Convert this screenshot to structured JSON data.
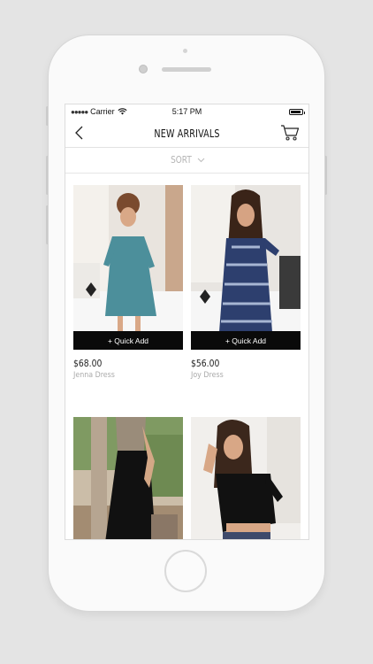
{
  "status": {
    "carrier": "Carrier",
    "time": "5:17 PM"
  },
  "nav": {
    "title": "NEW ARRIVALS",
    "back_icon": "chevron-left-icon",
    "cart_icon": "cart-icon"
  },
  "sort": {
    "label": "SORT",
    "icon": "chevron-down-icon"
  },
  "products": [
    {
      "price": "$68.00",
      "name": "Jenna Dress",
      "quick_add": "+ Quick Add"
    },
    {
      "price": "$56.00",
      "name": "Joy Dress",
      "quick_add": "+ Quick Add"
    },
    {
      "price": "",
      "name": "",
      "quick_add": ""
    },
    {
      "price": "",
      "name": "",
      "quick_add": ""
    }
  ],
  "colors": {
    "accent": "#0a0a0a",
    "muted_text": "#a9a9a9"
  }
}
